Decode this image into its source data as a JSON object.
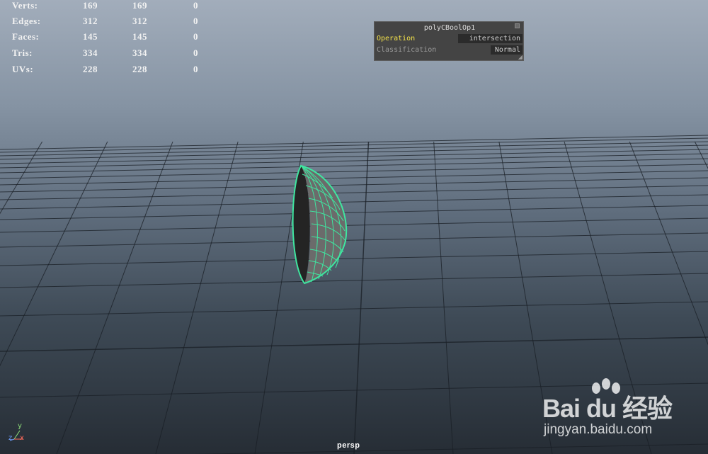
{
  "hud": {
    "rows": [
      {
        "label": "Verts:",
        "a": "169",
        "b": "169",
        "c": "0"
      },
      {
        "label": "Edges:",
        "a": "312",
        "b": "312",
        "c": "0"
      },
      {
        "label": "Faces:",
        "a": "145",
        "b": "145",
        "c": "0"
      },
      {
        "label": "Tris:",
        "a": "334",
        "b": "334",
        "c": "0"
      },
      {
        "label": "UVs:",
        "a": "228",
        "b": "228",
        "c": "0"
      }
    ]
  },
  "node_panel": {
    "title": "polyCBoolOp1",
    "operation_label": "Operation",
    "operation_value": "intersection",
    "classification_label": "Classification",
    "classification_value": "Normal"
  },
  "camera": {
    "name": "persp"
  },
  "axis": {
    "x": "x",
    "y": "y",
    "z": "z"
  },
  "watermark": {
    "logo": "Bai du 经验",
    "url": "jingyan.baidu.com"
  },
  "colors": {
    "wireframe": "#3fe6a0",
    "operation_label": "#f3e14a",
    "grid": "#1a1f25"
  }
}
